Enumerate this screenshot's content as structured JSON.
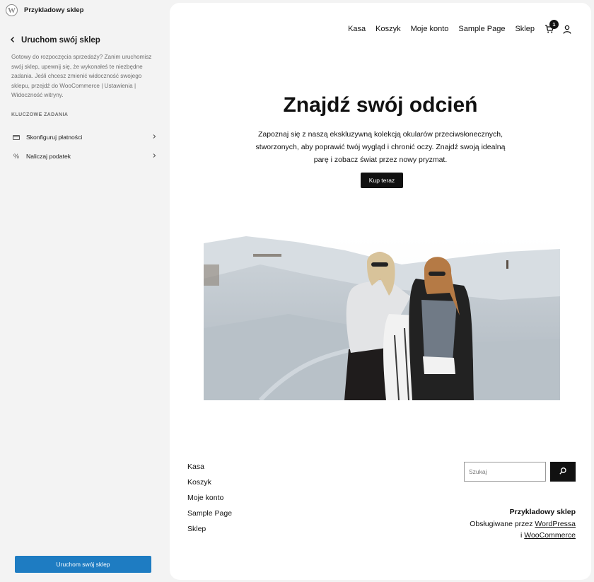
{
  "sidebar": {
    "site_name": "Przykladowy sklep",
    "logo_glyph": "W",
    "back_icon": "chevron-left-icon",
    "panel_title": "Uruchom swój sklep",
    "description": "Gotowy do rozpoczęcia sprzedaży? Zanim uruchomisz swój sklep, upewnij się, że wykonałeś te niezbędne zadania. Jeśli chcesz zmienić widoczność swojego sklepu, przejdź do WooCommerce | Ustawienia | Widoczność witryny.",
    "section_title": "KLUCZOWE ZADANIA",
    "tasks": [
      {
        "label": "Skonfiguruj płatności",
        "icon": "credit-card-icon"
      },
      {
        "label": "Naliczaj podatek",
        "icon": "percent-icon"
      }
    ],
    "launch_button": "Uruchom swój sklep"
  },
  "preview": {
    "nav": [
      "Kasa",
      "Koszyk",
      "Moje konto",
      "Sample Page",
      "Sklep"
    ],
    "cart_count": "1",
    "hero": {
      "title": "Znajdź swój odcień",
      "text": "Zapoznaj się z naszą ekskluzywną kolekcją okularów przeciwsłonecznych, stworzonych, aby poprawić twój wygląd i chronić oczy. Znajdź swoją idealną parę i zobacz świat przez nowy pryzmat.",
      "button": "Kup teraz"
    },
    "footer": {
      "links": [
        "Kasa",
        "Koszyk",
        "Moje konto",
        "Sample Page",
        "Sklep"
      ],
      "search_placeholder": "Szukaj",
      "site_name": "Przykladowy sklep",
      "powered_prefix": "Obsługiwane przez",
      "wordpress_link": "WordPressa",
      "and": "i",
      "woocommerce_link": "WooCommerce"
    }
  },
  "colors": {
    "primary_button": "#1e7cc2",
    "dark": "#111111",
    "sidebar_bg": "#f3f3f3"
  }
}
